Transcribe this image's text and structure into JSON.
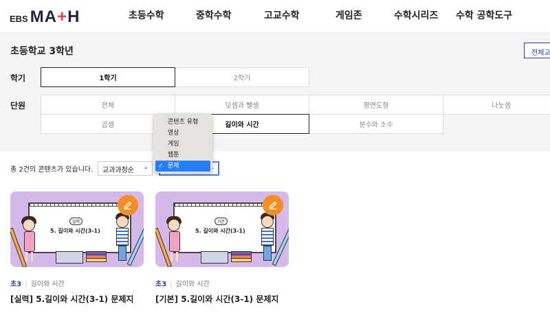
{
  "logo": {
    "prefix": "EBS",
    "main_a": "MA",
    "main_plus": "+",
    "main_b": "H"
  },
  "nav": [
    "초등수학",
    "중학수학",
    "고교수학",
    "게임존",
    "수학시리즈",
    "수학 공학도구"
  ],
  "page_title": "초등학교 3학년",
  "all_button": "전체교",
  "semester": {
    "label": "학기",
    "items": [
      "1학기",
      "2학기"
    ],
    "selected": "1학기"
  },
  "unit": {
    "label": "단원",
    "items": [
      "전체",
      "덧셈과 뺄셈",
      "평면도형",
      "나눗셈",
      "곱셈",
      "길이와 시간",
      "분수와 소수"
    ],
    "selected": "길이와 시간"
  },
  "count_text": "총 2건의 콘텐츠가 있습니다.",
  "sort_select": {
    "value": "교과과정순",
    "caret": "⌄"
  },
  "type_select": {
    "caret": "⌄"
  },
  "dropdown": {
    "options": [
      "콘텐츠 유형",
      "영상",
      "게임",
      "웹툰",
      "문제"
    ],
    "selected": "문제",
    "check": "✓"
  },
  "cards": [
    {
      "badge": "실력",
      "board_title": "5. 길이와 시간(3-1)",
      "grade": "초3",
      "unit": "길이와 시간",
      "title": "[실력] 5.길이와 시간(3-1) 문제지"
    },
    {
      "badge": "기본",
      "board_title": "5. 길이와 시간(3-1)",
      "grade": "초3",
      "unit": "길이와 시간",
      "title": "[기본] 5.길이와 시간(3-1) 문제지"
    }
  ],
  "colors": {
    "accent": "#2a3f9f",
    "edit_button": "#f58c24",
    "card_bg": "#d4b9ea",
    "dropdown_selected": "#2a7ef5"
  },
  "icons": {
    "edit": "edit-icon",
    "check": "check-icon",
    "caret": "chevron-down-icon"
  }
}
